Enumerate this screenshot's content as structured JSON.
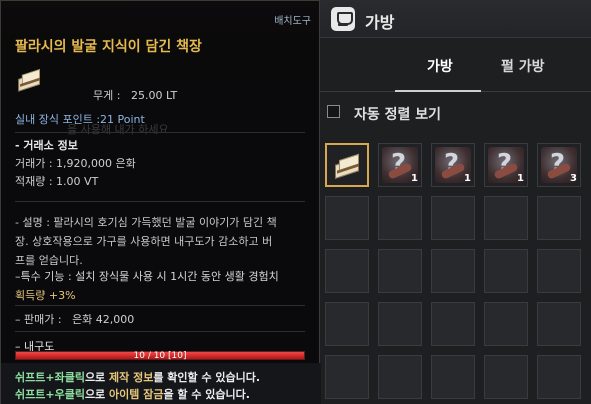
{
  "tooltip": {
    "category": "배치도구",
    "name": "팔라시의 발굴 지식이 담긴 책장",
    "weight_label": "무게 :",
    "weight_value": "25.00 LT",
    "deco_points": "실내 장식 포인트 :21 Point",
    "ghost_text": "을 사용해 내가 하세요",
    "trade_title": "- 거래소 정보",
    "trade_price": "거래가 : 1,920,000 은화",
    "trade_load": "적재량 : 1.00 VT",
    "desc_lines": [
      "- 설명 : 팔라시의 호기심 가득했던 발굴 이야기가 담긴 책",
      "장. 상호작용으로 가구를 사용하면 내구도가 감소하고 버",
      "프를 얻습니다."
    ],
    "special_prefix": "–특수 기능 : 설치 장식물 사용 시 1시간 동안 생활 경험치",
    "special_suffix": "획득량 +3%",
    "sell_label": "– 판매가 :",
    "sell_value": "은화 42,000",
    "durability_label": "– 내구도",
    "durability_text": "10 / 10  [10]",
    "durability_fraction": 1.0,
    "hint1": {
      "key": "쉬프트+좌클릭",
      "mid": "으로 ",
      "action": "제작 정보",
      "end": "를 확인할 수 있습니다."
    },
    "hint2": {
      "key": "쉬프트+우클릭",
      "mid": "으로 ",
      "action": "아이템 잠금",
      "end": "을 할 수 있습니다."
    }
  },
  "inventory": {
    "title": "가방",
    "tabs": [
      {
        "label": "가방",
        "active": true
      },
      {
        "label": "펄 가방",
        "active": false
      }
    ],
    "autosort_label": "자동 정렬 보기",
    "slots": [
      {
        "icon": "bookshelf-icon",
        "count": ""
      },
      {
        "icon": "mystery-scroll-icon",
        "count": "1"
      },
      {
        "icon": "mystery-scroll-icon",
        "count": "1"
      },
      {
        "icon": "mystery-scroll-icon",
        "count": "1"
      },
      {
        "icon": "mystery-scroll-icon",
        "count": "3"
      }
    ]
  }
}
